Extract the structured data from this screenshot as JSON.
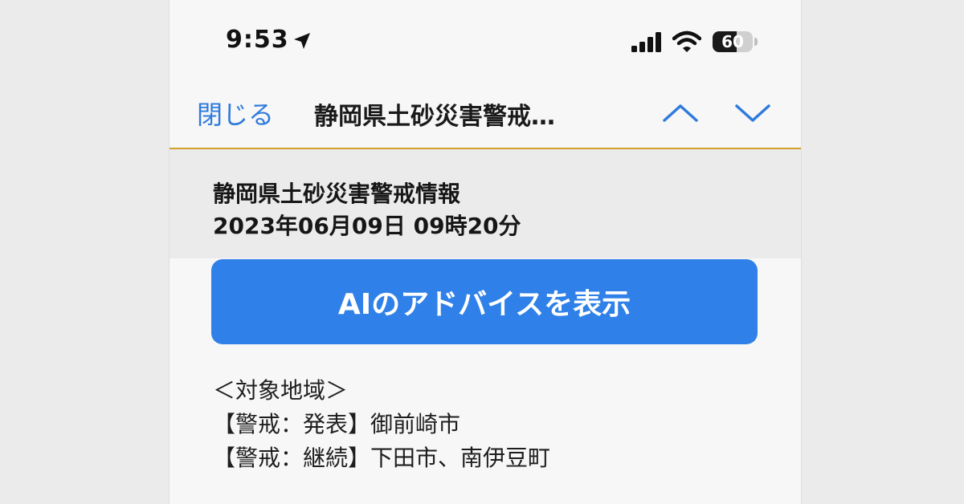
{
  "status_bar": {
    "time": "9:53",
    "battery": "60",
    "battery_level": 0.6,
    "icons": [
      "location-arrow-icon",
      "cellular-signal-icon",
      "wifi-icon",
      "battery-icon"
    ]
  },
  "nav": {
    "close_label": "閉じる",
    "title": "静岡県土砂災害警戒…",
    "icons": [
      "chevron-up-icon",
      "chevron-down-icon"
    ]
  },
  "message": {
    "title": "静岡県土砂災害警戒情報",
    "datetime": "2023年06月09日 09時20分"
  },
  "ai_button": {
    "label": "AIのアドバイスを表示"
  },
  "body": {
    "lines": [
      "＜対象地域＞",
      "【警戒：発表】御前崎市",
      "【警戒：継続】下田市、南伊豆町"
    ]
  },
  "colors": {
    "accent": "#2f80e8",
    "link": "#2f7bdc",
    "divider": "#d1a12c",
    "header_bg": "#ebebeb"
  }
}
